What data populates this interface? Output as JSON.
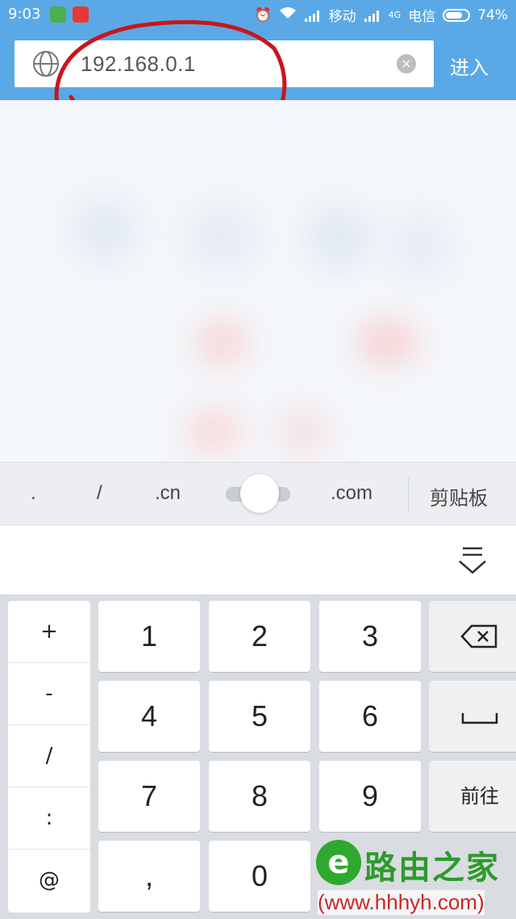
{
  "status_bar": {
    "time": "9:03",
    "carrier1": "移动",
    "net": "4G",
    "carrier2": "电信",
    "battery": "74%"
  },
  "address_bar": {
    "url": "192.168.0.1",
    "clear_symbol": "×",
    "go_label": "进入"
  },
  "suggestions": {
    "items": [
      ".",
      "/",
      ".cn",
      ".com"
    ],
    "clipboard": "剪贴板"
  },
  "keyboard": {
    "symbols": [
      "+",
      "-",
      "/",
      ":",
      "@"
    ],
    "digits": [
      "1",
      "2",
      "3",
      "4",
      "5",
      "6",
      "7",
      "8",
      "9",
      ",",
      "0"
    ],
    "go_label": "前往"
  },
  "watermark": {
    "logo_char": "e",
    "text": "路由之家",
    "url": "(www.hhhyh.com)"
  },
  "colors": {
    "accent": "#5aa9e6",
    "annotation": "#c8161d"
  }
}
